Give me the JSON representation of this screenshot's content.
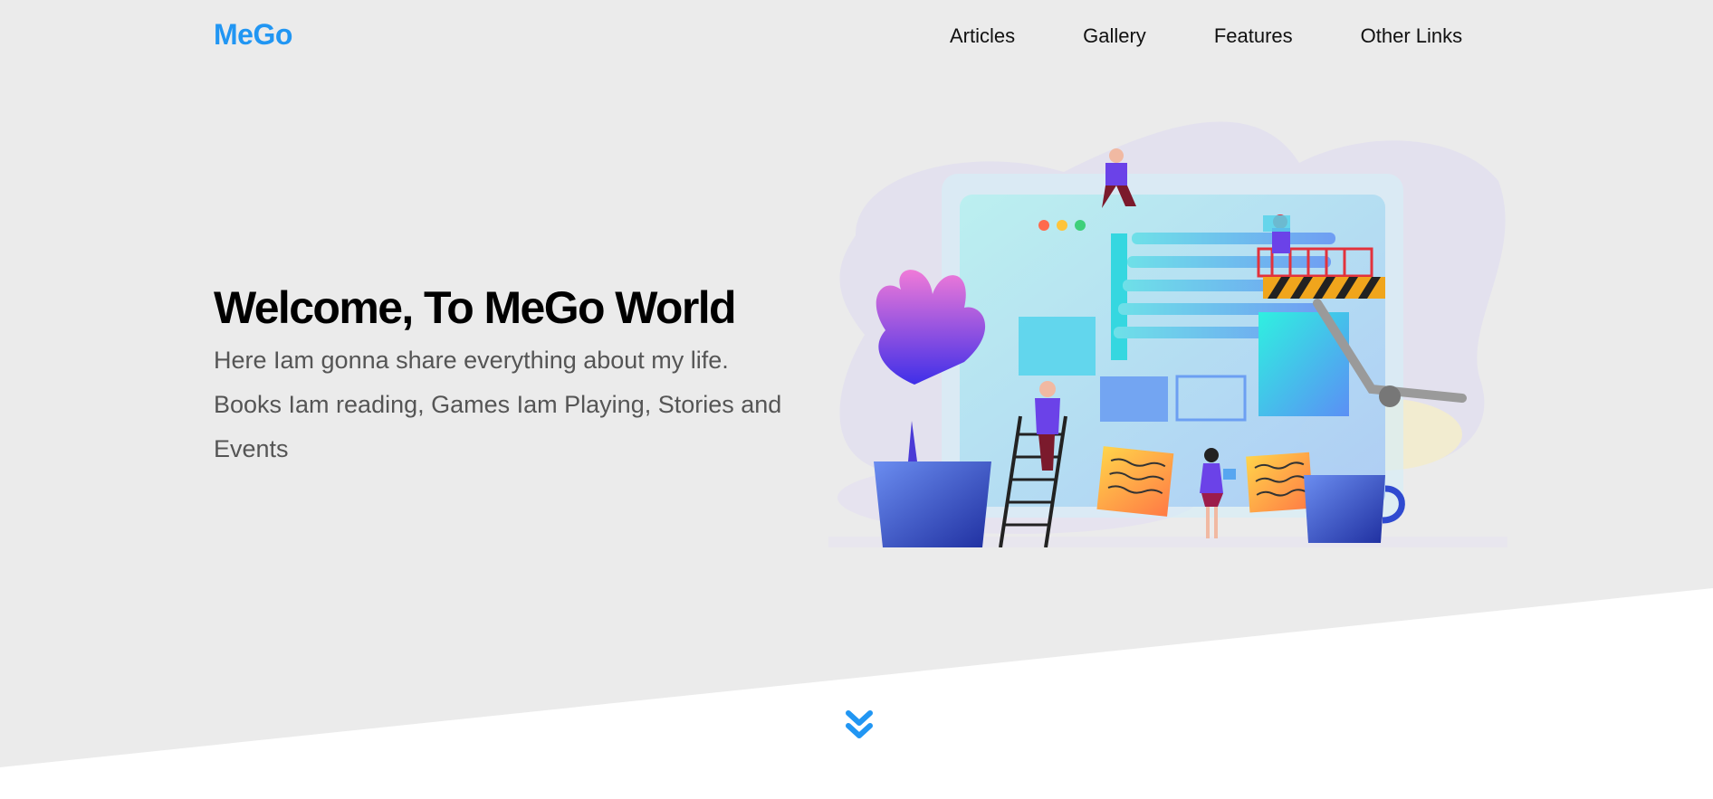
{
  "header": {
    "logo": "MeGo",
    "nav": [
      {
        "label": "Articles"
      },
      {
        "label": "Gallery"
      },
      {
        "label": "Features"
      },
      {
        "label": "Other Links"
      }
    ]
  },
  "hero": {
    "title": "Welcome, To MeGo World",
    "subtitle": "Here Iam gonna share everything about my life. Books Iam reading, Games Iam Playing, Stories and Events"
  },
  "icons": {
    "scroll_down": "double-chevron-down-icon"
  },
  "colors": {
    "brand": "#2196f3",
    "hero_background": "#ebebeb",
    "page_background": "#ffffff",
    "text": "#111111",
    "muted_text": "#555555"
  }
}
